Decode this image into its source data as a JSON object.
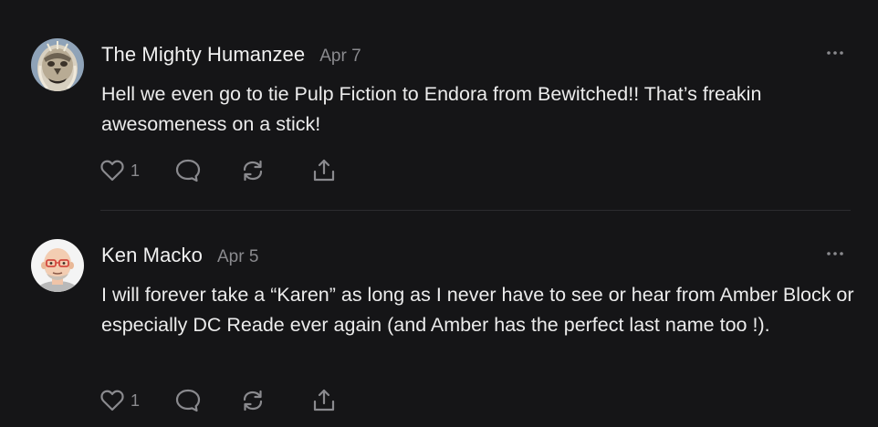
{
  "comments": [
    {
      "author": "The Mighty Humanzee",
      "date": "Apr 7",
      "text": "Hell we even go to tie Pulp Fiction to Endora from Bewitched!! That’s freakin awesomeness on a stick!",
      "like_count": "1",
      "avatar_icon": "creature-mask-avatar",
      "more_icon": "ellipsis-icon"
    },
    {
      "author": "Ken Macko",
      "date": "Apr 5",
      "text": "I will forever take a “Karen” as long as I never have to see or hear from Amber Block or especially DC Reade ever again (and Amber has the perfect last name too !).",
      "like_count": "1",
      "avatar_icon": "bald-man-glasses-avatar",
      "more_icon": "ellipsis-icon"
    }
  ],
  "action_icons": [
    "heart-icon",
    "reply-bubble-icon",
    "restack-icon",
    "share-icon"
  ],
  "colors": {
    "background": "#151517",
    "text": "#ececec",
    "muted": "#8a8a8e",
    "divider": "#2c2c2f"
  }
}
